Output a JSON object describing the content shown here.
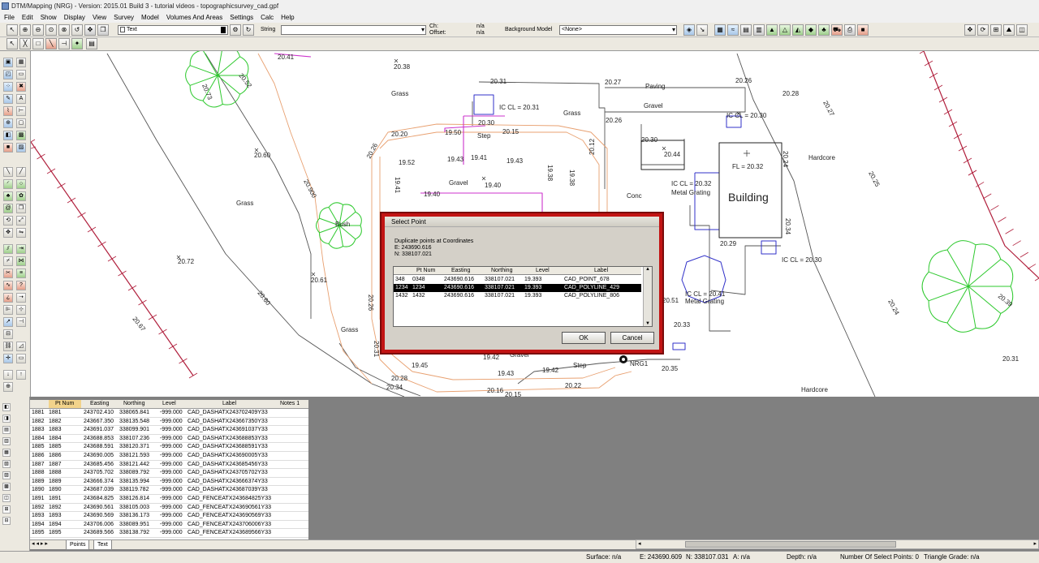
{
  "window": {
    "title": "DTM/Mapping (NRG) - Version: 2015.01 Build 3 - tutorial videos - topographicsurvey_cad.gpf"
  },
  "menu": [
    "File",
    "Edit",
    "Show",
    "Display",
    "View",
    "Survey",
    "Model",
    "Volumes And Areas",
    "Settings",
    "Calc",
    "Help"
  ],
  "toolbar": {
    "layer_value": "Text",
    "string_label": "String",
    "string_value": "",
    "ch_label": "Ch:",
    "ch_value": "n/a",
    "offset_label": "Offset:",
    "offset_value": "n/a",
    "background_model_label": "Background Model",
    "background_model_value": "<None>"
  },
  "colors": {
    "accent_red": "#c21414",
    "grass_green": "#2ec92e",
    "magenta": "#cc33cc",
    "blue": "#3030c8",
    "orange": "#e8a070",
    "dark_red": "#b01f3c"
  },
  "cad": {
    "labels": [
      {
        "text": "20.41",
        "cls": "t"
      },
      {
        "text": "20.38",
        "cls": "t"
      },
      {
        "text": "20.52",
        "cls": "t"
      },
      {
        "text": "20.73",
        "cls": "t"
      },
      {
        "text": "Grass",
        "cls": "t"
      },
      {
        "text": "20.31",
        "cls": "t"
      },
      {
        "text": "20.27",
        "cls": "t"
      },
      {
        "text": "Paving",
        "cls": "t"
      },
      {
        "text": "20.26",
        "cls": "t"
      },
      {
        "text": "20.28",
        "cls": "t"
      },
      {
        "text": "20.27",
        "cls": "t"
      },
      {
        "text": "IC CL = 20.31",
        "cls": "t"
      },
      {
        "text": "Grass",
        "cls": "t"
      },
      {
        "text": "Gravel",
        "cls": "t"
      },
      {
        "text": "IC CL = 20.30",
        "cls": "t"
      },
      {
        "text": "20.26",
        "cls": "t"
      },
      {
        "text": "20.30",
        "cls": "t"
      },
      {
        "text": "20.15",
        "cls": "t"
      },
      {
        "text": "Step",
        "cls": "t"
      },
      {
        "text": "20.20",
        "cls": "t"
      },
      {
        "text": "19.50",
        "cls": "t"
      },
      {
        "text": "20.30",
        "cls": "t"
      },
      {
        "text": "20.44",
        "cls": "t"
      },
      {
        "text": "20.24",
        "cls": "t"
      },
      {
        "text": "Hardcore",
        "cls": "t"
      },
      {
        "text": "FL = 20.32",
        "cls": "t"
      },
      {
        "text": "20.60",
        "cls": "t"
      },
      {
        "text": "20.26",
        "cls": "t"
      },
      {
        "text": "19.52",
        "cls": "t"
      },
      {
        "text": "19.43",
        "cls": "t"
      },
      {
        "text": "19.41",
        "cls": "t"
      },
      {
        "text": "19.43",
        "cls": "t"
      },
      {
        "text": "19.38",
        "cls": "t"
      },
      {
        "text": "19.38",
        "cls": "t"
      },
      {
        "text": "20.12",
        "cls": "t"
      },
      {
        "text": "Gravel",
        "cls": "t"
      },
      {
        "text": "19.40",
        "cls": "t"
      },
      {
        "text": "19.41",
        "cls": "t"
      },
      {
        "text": "IC CL = 20.32",
        "cls": "t"
      },
      {
        "text": "Metal Grating",
        "cls": "t"
      },
      {
        "text": "Building",
        "cls": "big"
      },
      {
        "text": "20.25",
        "cls": "t"
      },
      {
        "text": "19.40",
        "cls": "t"
      },
      {
        "text": "Conc",
        "cls": "t"
      },
      {
        "text": "Grass",
        "cls": "t"
      },
      {
        "text": "20.900",
        "cls": "t"
      },
      {
        "text": "Bush",
        "cls": "t"
      },
      {
        "text": "20.34",
        "cls": "t"
      },
      {
        "text": "20.29",
        "cls": "t"
      },
      {
        "text": "20.72",
        "cls": "t"
      },
      {
        "text": "IC CL = 20.30",
        "cls": "t"
      },
      {
        "text": "20.61",
        "cls": "t"
      },
      {
        "text": "20.60",
        "cls": "t"
      },
      {
        "text": "20.67",
        "cls": "t"
      },
      {
        "text": "IC CL = 20.41",
        "cls": "t"
      },
      {
        "text": "Metal Grating",
        "cls": "t"
      },
      {
        "text": "20.51",
        "cls": "t"
      },
      {
        "text": "20.26",
        "cls": "t"
      },
      {
        "text": "20.24",
        "cls": "t"
      },
      {
        "text": "20.39",
        "cls": "t"
      },
      {
        "text": "Grass",
        "cls": "t"
      },
      {
        "text": "20.33",
        "cls": "t"
      },
      {
        "text": "20.31",
        "cls": "t"
      },
      {
        "text": "20.31",
        "cls": "t"
      },
      {
        "text": "19.42",
        "cls": "t"
      },
      {
        "text": "Gravel",
        "cls": "t"
      },
      {
        "text": "NRG1",
        "cls": "t"
      },
      {
        "text": "19.45",
        "cls": "t"
      },
      {
        "text": "Step",
        "cls": "t"
      },
      {
        "text": "20.35",
        "cls": "t"
      },
      {
        "text": "19.43",
        "cls": "t"
      },
      {
        "text": "19.42",
        "cls": "t"
      },
      {
        "text": "20.15",
        "cls": "t"
      },
      {
        "text": "20.28",
        "cls": "t"
      },
      {
        "text": "20.34",
        "cls": "t"
      },
      {
        "text": "20.22",
        "cls": "t"
      },
      {
        "text": "20.16",
        "cls": "t"
      },
      {
        "text": "Hardcore",
        "cls": "t"
      }
    ]
  },
  "dialog": {
    "title": "Select Point",
    "message": "Duplicate points at Coordinates",
    "easting": "E: 243690.616",
    "northing": "N: 338107.021",
    "columns": [
      "",
      "Pt Num",
      "Easting",
      "Northing",
      "Level",
      "Label"
    ],
    "rows": [
      {
        "id": "348",
        "pt": "0348",
        "e": "243690.616",
        "n": "338107.021",
        "lvl": "19.393",
        "label": "CAD_POINT_678",
        "selected": false
      },
      {
        "id": "1234",
        "pt": "1234",
        "e": "243690.616",
        "n": "338107.021",
        "lvl": "19.393",
        "label": "CAD_POLYLINE_429",
        "selected": true
      },
      {
        "id": "1432",
        "pt": "1432",
        "e": "243690.616",
        "n": "338107.021",
        "lvl": "19.393",
        "label": "CAD_POLYLINE_806",
        "selected": false
      }
    ],
    "ok_label": "OK",
    "cancel_label": "Cancel"
  },
  "grid": {
    "columns": [
      "",
      "Pt Num",
      "Easting",
      "Northing",
      "Level",
      "Label",
      "Notes 1"
    ],
    "rows": [
      [
        "1881",
        "1881",
        "243702.410",
        "338065.841",
        "-999.000",
        "CAD_DASHATX243702409Y33"
      ],
      [
        "1882",
        "1882",
        "243667.350",
        "338135.548",
        "-999.000",
        "CAD_DASHATX243667350Y33"
      ],
      [
        "1883",
        "1883",
        "243691.037",
        "338099.901",
        "-999.000",
        "CAD_DASHATX243691037Y33"
      ],
      [
        "1884",
        "1884",
        "243688.853",
        "338107.236",
        "-999.000",
        "CAD_DASHATX243688853Y33"
      ],
      [
        "1885",
        "1885",
        "243688.591",
        "338120.371",
        "-999.000",
        "CAD_DASHATX243688591Y33"
      ],
      [
        "1886",
        "1886",
        "243690.005",
        "338121.593",
        "-999.000",
        "CAD_DASHATX243690005Y33"
      ],
      [
        "1887",
        "1887",
        "243685.456",
        "338121.442",
        "-999.000",
        "CAD_DASHATX243685456Y33"
      ],
      [
        "1888",
        "1888",
        "243705.702",
        "338089.792",
        "-999.000",
        "CAD_DASHATX243705702Y33"
      ],
      [
        "1889",
        "1889",
        "243666.374",
        "338135.994",
        "-999.000",
        "CAD_DASHATX243666374Y33"
      ],
      [
        "1890",
        "1890",
        "243687.039",
        "338119.782",
        "-999.000",
        "CAD_DASHATX243687039Y33"
      ],
      [
        "1891",
        "1891",
        "243684.825",
        "338126.814",
        "-999.000",
        "CAD_FENCEATX243684825Y33"
      ],
      [
        "1892",
        "1892",
        "243690.561",
        "338105.003",
        "-999.000",
        "CAD_FENCEATX243690561Y33"
      ],
      [
        "1893",
        "1893",
        "243690.569",
        "338136.173",
        "-999.000",
        "CAD_FENCEATX243690569Y33"
      ],
      [
        "1894",
        "1894",
        "243706.006",
        "338089.951",
        "-999.000",
        "CAD_FENCEATX243706006Y33"
      ],
      [
        "1895",
        "1895",
        "243689.566",
        "338138.792",
        "-999.000",
        "CAD_FENCEATX243689566Y33"
      ]
    ]
  },
  "tabs": [
    "Points",
    "Text"
  ],
  "status": {
    "surface": "Surface: n/a",
    "e": "E: 243690.609",
    "n": "N: 338107.031",
    "a": "A: n/a",
    "depth": "Depth: n/a",
    "select_points": "Number Of Select Points: 0",
    "triangle_grade": "Triangle Grade: n/a"
  }
}
